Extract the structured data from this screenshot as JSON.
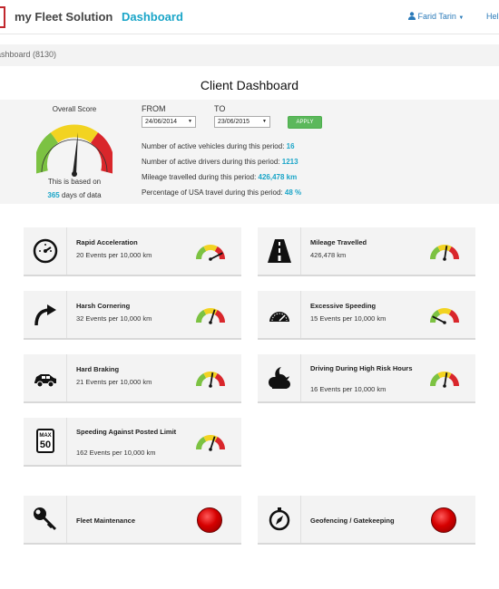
{
  "header": {
    "app_name": "my Fleet Solution",
    "dashboard_link": "Dashboard",
    "user_name": "Farid Tarin",
    "help_link": "Hel"
  },
  "breadcrumb": "ashboard (8130)",
  "page_title": "Client Dashboard",
  "summary": {
    "overall_score_label": "Overall Score",
    "based_on_text": "This is based on",
    "days_value": "365",
    "days_suffix": "days of data",
    "from_label": "FROM",
    "to_label": "TO",
    "from_date": "24/06/2014",
    "to_date": "23/06/2015",
    "apply_label": "APPLY",
    "stats": [
      {
        "label": "Number of active vehicles during this period:",
        "value": "16"
      },
      {
        "label": "Number of active drivers during this period:",
        "value": "1213"
      },
      {
        "label": "Mileage travelled during this period:",
        "value": "426,478 km"
      },
      {
        "label": "Percentage of USA travel during this period:",
        "value": "48 %"
      }
    ]
  },
  "tiles": [
    {
      "title": "Rapid Acceleration",
      "subtitle": "20 Events per 10,000 km",
      "icon": "speedometer-icon",
      "indicator": "gauge",
      "level": 0.85
    },
    {
      "title": "Mileage Travelled",
      "subtitle": "426,478 km",
      "icon": "road-icon",
      "indicator": "gauge",
      "level": 0.55
    },
    {
      "title": "Harsh Cornering",
      "subtitle": "32 Events per 10,000 km",
      "icon": "turn-arrow-icon",
      "indicator": "gauge",
      "level": 0.6
    },
    {
      "title": "Excessive Speeding",
      "subtitle": "15 Events per 10,000 km",
      "icon": "speed-gauge-icon",
      "indicator": "gauge",
      "level": 0.15
    },
    {
      "title": "Hard Braking",
      "subtitle": "21 Events per 10,000 km",
      "icon": "car-braking-icon",
      "indicator": "gauge",
      "level": 0.55
    },
    {
      "title": "Driving During High Risk Hours",
      "subtitle": "16 Events per 10,000 km",
      "icon": "night-cloud-icon",
      "indicator": "gauge",
      "level": 0.55
    },
    {
      "title": "Speeding Against Posted Limit",
      "subtitle": "162 Events per 10,000 km",
      "icon": "speed-limit-sign-icon",
      "sign_top": "MAX",
      "sign_value": "50",
      "indicator": "gauge",
      "level": 0.6
    },
    {
      "title": "Fleet Maintenance",
      "subtitle": "",
      "icon": "wrench-icon",
      "indicator": "status-dot",
      "status_color": "#d60000"
    },
    {
      "title": "Geofencing / Gatekeeping",
      "subtitle": "",
      "icon": "compass-icon",
      "indicator": "status-dot",
      "status_color": "#d60000"
    }
  ],
  "colors": {
    "accent": "#1aa5c8",
    "apply_button": "#5cb85c",
    "gauge_green": "#7cc242",
    "gauge_yellow": "#f2d321",
    "gauge_red": "#d9262b",
    "status_red": "#d60000"
  }
}
